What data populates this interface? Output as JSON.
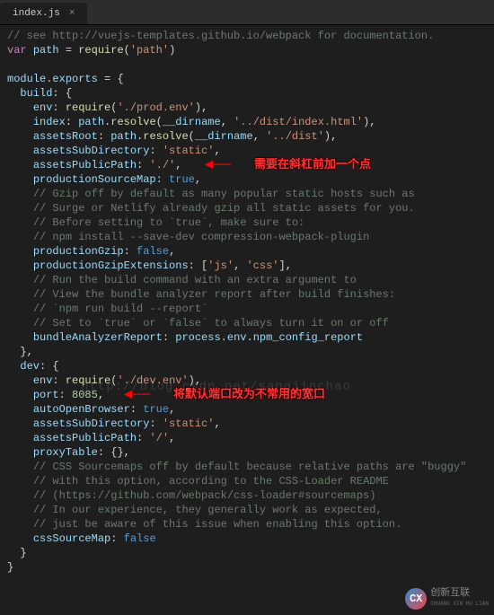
{
  "tab": {
    "filename": "index.js",
    "close": "×"
  },
  "annotations": {
    "a1": "需要在斜杠前加一个点",
    "a2": "将默认端口改为不常用的宽口"
  },
  "watermark": "http://blog.csdn.net/sangjinchao",
  "logo": {
    "mark": "CX",
    "name": "创新互联",
    "sub": "CHUANG XIN HU LIAN"
  },
  "code": {
    "c1a": "// see http://vuejs-templates.github.io/webpack for documentation.",
    "kw_var": "var",
    "path_id": "path",
    "eq": " = ",
    "require": "require",
    "lp": "(",
    "rp": ")",
    "sc": ";",
    "cm": ",",
    "s_path": "'path'",
    "module": "module",
    "dot": ".",
    "exports": "exports",
    "lb": "{",
    "rb": "}",
    "build": "build",
    "colon": ": ",
    "env": "env",
    "s_prod": "'./prod.env'",
    "index": "index",
    "resolve": "resolve",
    "dirname": "__dirname",
    "s_indexhtml": "'../dist/index.html'",
    "assetsRoot": "assetsRoot",
    "s_dist": "'../dist'",
    "assetsSubDirectory": "assetsSubDirectory",
    "s_static": "'static'",
    "assetsPublicPath": "assetsPublicPath",
    "s_app": "'./'",
    "productionSourceMap": "productionSourceMap",
    "true": "true",
    "false": "false",
    "c_gzip1": "// Gzip off by default as many popular static hosts such as",
    "c_gzip2": "// Surge or Netlify already gzip all static assets for you.",
    "c_gzip3": "// Before setting to `true`, make sure to:",
    "c_gzip4": "// npm install --save-dev compression-webpack-plugin",
    "productionGzip": "productionGzip",
    "productionGzipExtensions": "productionGzipExtensions",
    "lbr": "[",
    "rbr": "]",
    "s_js": "'js'",
    "s_css": "'css'",
    "c_ba1": "// Run the build command with an extra argument to",
    "c_ba2": "// View the bundle analyzer report after build finishes:",
    "c_ba3": "// `npm run build --report`",
    "c_ba4": "// Set to `true` or `false` to always turn it on or off",
    "bundleAnalyzerReport": "bundleAnalyzerReport",
    "process": "process",
    "envp": "env",
    "npm_config_report": "npm_config_report",
    "dev": "dev",
    "s_devenv": "'./dev.env'",
    "port": "port",
    "n_port": "8085",
    "autoOpenBrowser": "autoOpenBrowser",
    "s_slash": "'/'",
    "proxyTable": "proxyTable",
    "c_css1": "// CSS Sourcemaps off by default because relative paths are \"buggy\"",
    "c_css2": "// with this option, according to the CSS-Loader README",
    "c_css3": "// (https://github.com/webpack/css-loader#sourcemaps)",
    "c_css4": "// In our experience, they generally work as expected,",
    "c_css5": "// just be aware of this issue when enabling this option.",
    "cssSourceMap": "cssSourceMap"
  }
}
